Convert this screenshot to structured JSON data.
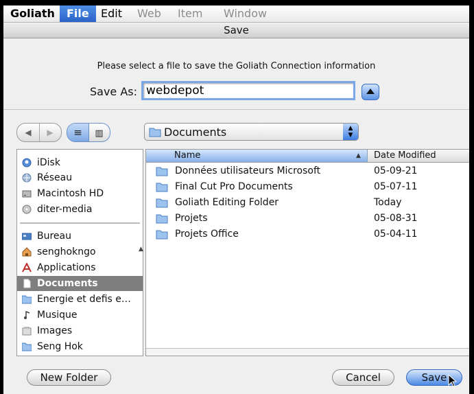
{
  "menubar": {
    "app": "Goliath",
    "items": [
      "File",
      "Edit",
      "Web",
      "Item",
      "Window"
    ],
    "active": "File"
  },
  "dialog": {
    "title": "Save",
    "prompt": "Please select a file to save the Goliath Connection information",
    "save_as_label": "Save As:",
    "save_as_value": "webdepot",
    "location": "Documents"
  },
  "sidebar": {
    "devices": [
      {
        "label": "iDisk",
        "icon": "idisk-icon"
      },
      {
        "label": "Réseau",
        "icon": "network-icon"
      },
      {
        "label": "Macintosh HD",
        "icon": "hard-drive-icon"
      },
      {
        "label": "diter-media",
        "icon": "disk-icon"
      }
    ],
    "places": [
      {
        "label": "Bureau",
        "icon": "desktop-icon"
      },
      {
        "label": "senghokngo",
        "icon": "home-icon"
      },
      {
        "label": "Applications",
        "icon": "applications-icon"
      },
      {
        "label": "Documents",
        "icon": "documents-icon",
        "selected": true
      },
      {
        "label": "Energie et defis e…",
        "icon": "folder-icon"
      },
      {
        "label": "Musique",
        "icon": "music-icon"
      },
      {
        "label": "Images",
        "icon": "images-icon"
      },
      {
        "label": "Seng Hok",
        "icon": "folder-icon"
      }
    ]
  },
  "file_list": {
    "columns": {
      "name": "Name",
      "date": "Date Modified"
    },
    "rows": [
      {
        "name": "Données utilisateurs Microsoft",
        "date": "05-09-21"
      },
      {
        "name": "Final Cut Pro Documents",
        "date": "05-07-11"
      },
      {
        "name": "Goliath Editing Folder",
        "date": "Today"
      },
      {
        "name": "Projets",
        "date": "05-08-31"
      },
      {
        "name": "Projets Office",
        "date": "05-04-11"
      }
    ]
  },
  "buttons": {
    "new_folder": "New Folder",
    "cancel": "Cancel",
    "save": "Save"
  },
  "colors": {
    "accent": "#3f7fe0",
    "selection": "#7f7f7f"
  }
}
